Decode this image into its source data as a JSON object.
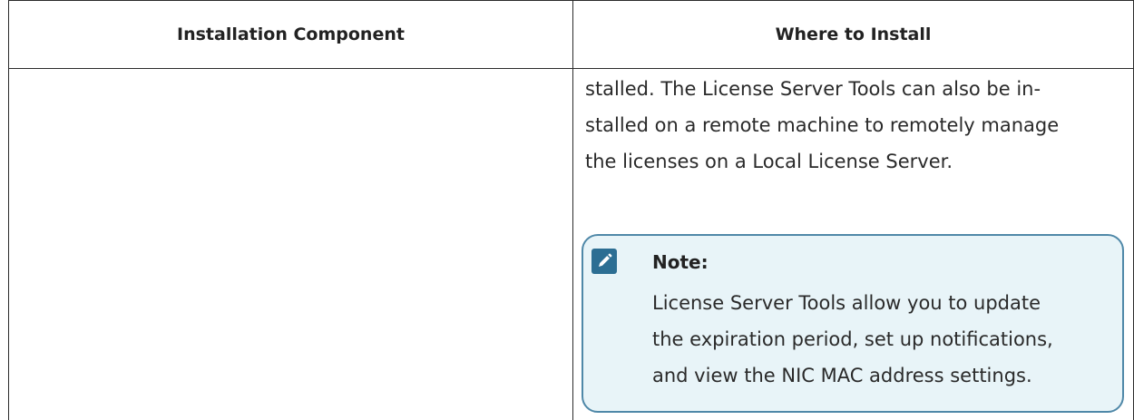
{
  "table": {
    "headers": [
      "Installation Component",
      "Where to Install"
    ],
    "row": {
      "component": "",
      "where_lines": [
        "stalled. The License Server Tools can also be in-",
        "stalled on a remote machine to remotely manage",
        "the licenses on a Local License Server."
      ]
    }
  },
  "note": {
    "icon": "pencil-note-icon",
    "title": "Note:",
    "body_lines": [
      "License Server Tools allow you to update",
      "the expiration period, set up notifications,",
      "and view the NIC MAC address settings."
    ]
  },
  "colors": {
    "note_background": "#e8f4f8",
    "note_border": "#4f88a8",
    "note_icon": "#2c6e93",
    "table_border": "#2b2b2b"
  }
}
